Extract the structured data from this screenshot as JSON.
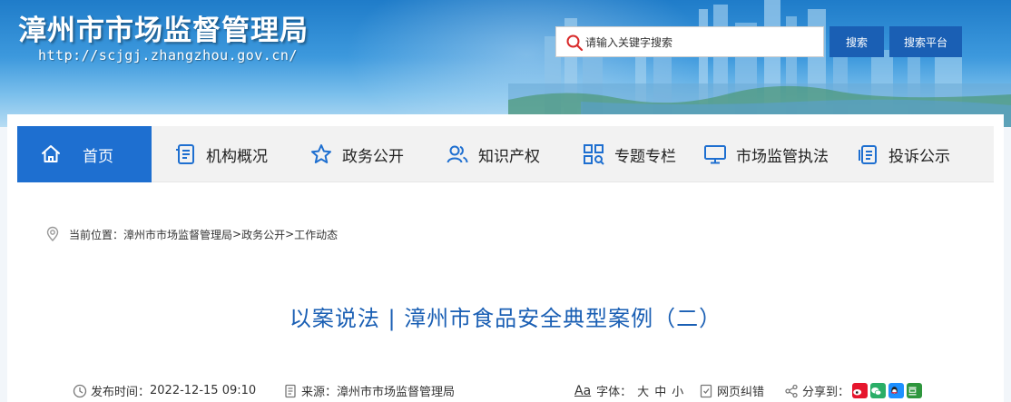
{
  "header": {
    "site_title": "漳州市市场监督管理局",
    "site_url": "http://scjgj.zhangzhou.gov.cn/",
    "search_placeholder": "请输入关键字搜索",
    "search_button": "搜索",
    "platform_button": "搜索平台"
  },
  "nav": {
    "items": [
      {
        "label": "首页",
        "icon": "home-icon",
        "active": true
      },
      {
        "label": "机构概况",
        "icon": "document-list-icon"
      },
      {
        "label": "政务公开",
        "icon": "star-icon"
      },
      {
        "label": "知识产权",
        "icon": "users-icon"
      },
      {
        "label": "专题专栏",
        "icon": "grid-search-icon"
      },
      {
        "label": "市场监管执法",
        "icon": "monitor-icon"
      },
      {
        "label": "投诉公示",
        "icon": "copy-document-icon"
      }
    ]
  },
  "breadcrumb": {
    "prefix": "当前位置：",
    "level1": "漳州市市场监督管理局",
    "sep": ">",
    "level2": "政务公开",
    "level3": "工作动态"
  },
  "article": {
    "title": "以案说法 | 漳州市食品安全典型案例（二）",
    "publish_label": "发布时间：",
    "publish_time": "2022-12-15 09:10",
    "source_label": "来源：",
    "source": "漳州市市场监督管理局",
    "font_icon_text": "Aa",
    "font_label": "字体：",
    "font_large": "大",
    "font_medium": "中",
    "font_small": "小",
    "correction": "网页纠错",
    "share_label": "分享到："
  },
  "colors": {
    "primary": "#1e6fd0",
    "title_blue": "#1a5fb4",
    "weibo": "#e6162d",
    "wechat": "#2aae67",
    "qq": "#1e90ff",
    "douban": "#2e963d"
  }
}
